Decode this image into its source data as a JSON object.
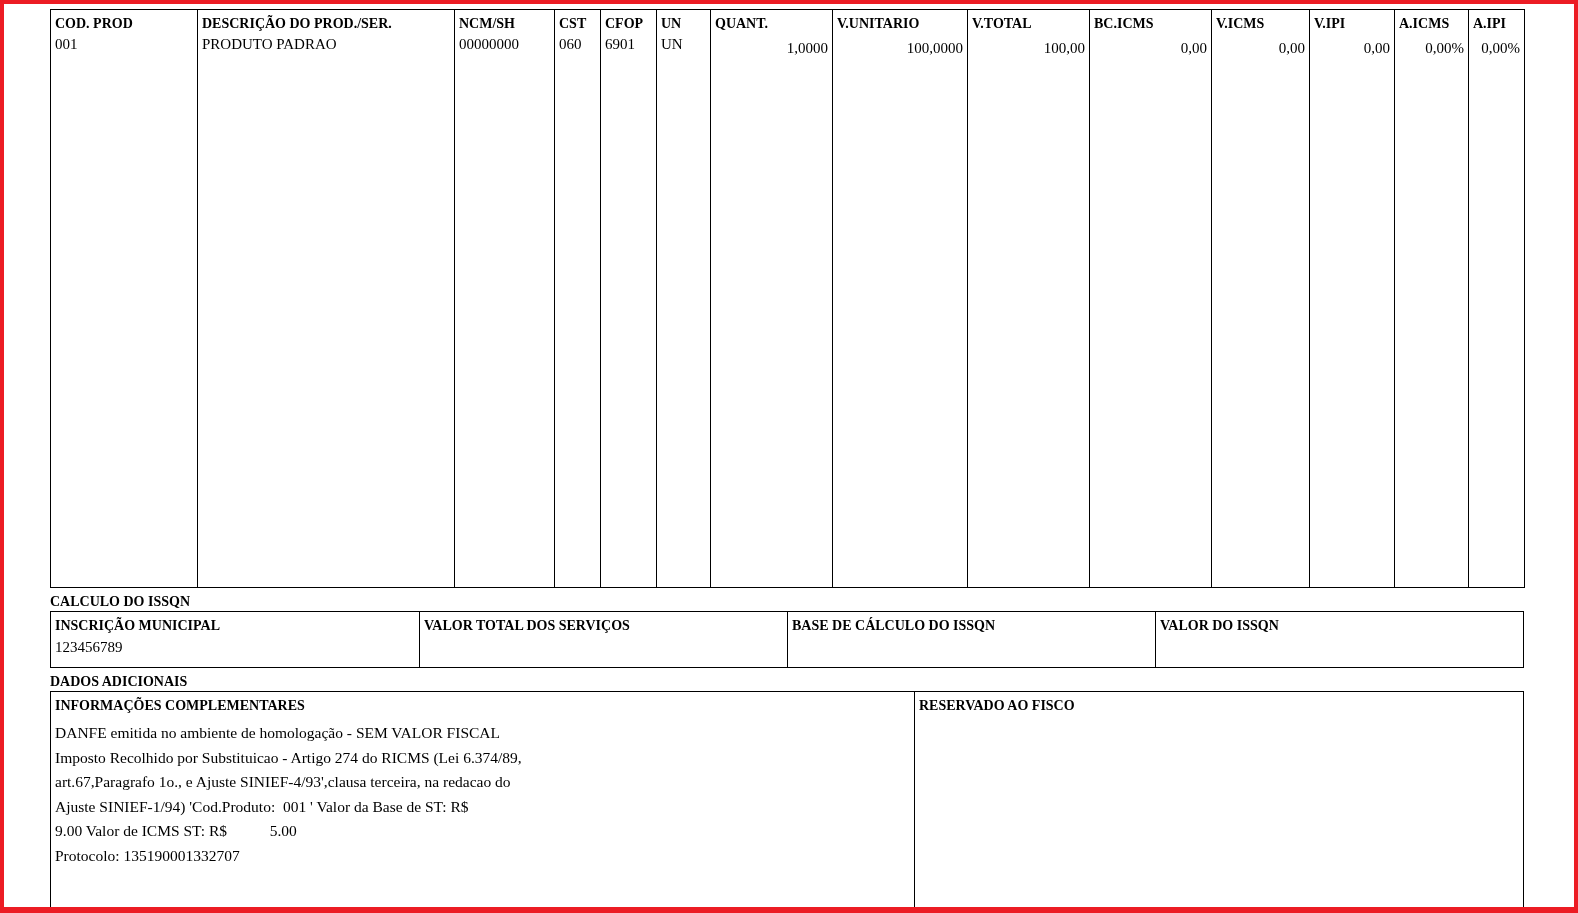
{
  "products": {
    "columns": [
      {
        "label": "COD. PROD",
        "numeric": false
      },
      {
        "label": "DESCRIÇÃO DO PROD./SER.",
        "numeric": false
      },
      {
        "label": "NCM/SH",
        "numeric": false
      },
      {
        "label": "CST",
        "numeric": false
      },
      {
        "label": "CFOP",
        "numeric": false
      },
      {
        "label": "UN",
        "numeric": false
      },
      {
        "label": "QUANT.",
        "numeric": true
      },
      {
        "label": "V.UNITARIO",
        "numeric": true
      },
      {
        "label": "V.TOTAL",
        "numeric": true
      },
      {
        "label": "BC.ICMS",
        "numeric": true
      },
      {
        "label": "V.ICMS",
        "numeric": true
      },
      {
        "label": "V.IPI",
        "numeric": true
      },
      {
        "label": "A.ICMS",
        "numeric": true
      },
      {
        "label": "A.IPI",
        "numeric": true
      }
    ],
    "rows": [
      [
        "001",
        "PRODUTO PADRAO",
        "00000000",
        "060",
        "6901",
        "UN",
        "1,0000",
        "100,0000",
        "100,00",
        "0,00",
        "0,00",
        "0,00",
        "0,00%",
        "0,00%"
      ]
    ]
  },
  "issqn": {
    "title": "CALCULO DO ISSQN",
    "fields": [
      {
        "label": "INSCRIÇÃO MUNICIPAL",
        "value": "123456789"
      },
      {
        "label": "VALOR TOTAL DOS SERVIÇOS"
      },
      {
        "label": "BASE DE CÁLCULO DO ISSQN"
      },
      {
        "label": "VALOR DO ISSQN"
      }
    ]
  },
  "additional": {
    "title": "DADOS ADICIONAIS",
    "info": {
      "label": "INFORMAÇÕES COMPLEMENTARES",
      "lines": [
        "DANFE emitida no ambiente de homologação - SEM VALOR FISCAL",
        "Imposto Recolhido por Substituicao - Artigo 274 do RICMS (Lei 6.374/89,",
        "art.67,Paragrafo 1o., e Ajuste SINIEF-4/93',clausa terceira, na redacao do",
        "Ajuste SINIEF-1/94) 'Cod.Produto:  001 ' Valor da Base de ST: R$",
        "9.00 Valor de ICMS ST: R$           5.00",
        "Protocolo: 135190001332707"
      ]
    },
    "reserved": {
      "label": "RESERVADO AO FISCO"
    }
  }
}
